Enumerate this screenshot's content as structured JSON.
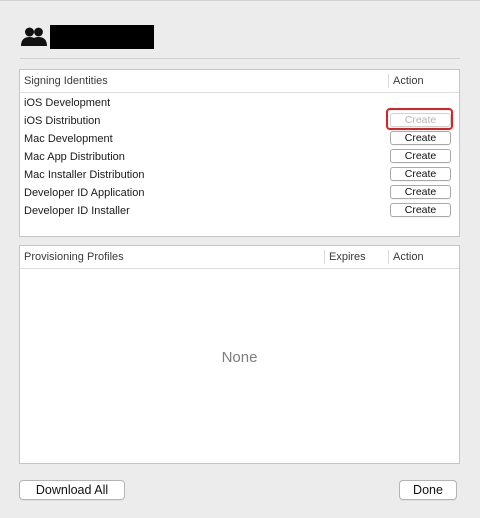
{
  "account": {
    "icon": "users-icon",
    "name": "",
    "redacted": true
  },
  "signing": {
    "col_name": "Signing Identities",
    "col_action": "Action",
    "rows": [
      {
        "name": "iOS Development",
        "action": "",
        "enabled": false
      },
      {
        "name": "iOS Distribution",
        "action": "Create",
        "enabled": false,
        "highlighted": true
      },
      {
        "name": "Mac Development",
        "action": "Create",
        "enabled": true
      },
      {
        "name": "Mac App Distribution",
        "action": "Create",
        "enabled": true
      },
      {
        "name": "Mac Installer Distribution",
        "action": "Create",
        "enabled": true
      },
      {
        "name": "Developer ID Application",
        "action": "Create",
        "enabled": true
      },
      {
        "name": "Developer ID Installer",
        "action": "Create",
        "enabled": true
      }
    ]
  },
  "profiles": {
    "col_name": "Provisioning Profiles",
    "col_expires": "Expires",
    "col_action": "Action",
    "empty_text": "None"
  },
  "footer": {
    "download_all": "Download All",
    "done": "Done"
  },
  "colors": {
    "background": "#ececec",
    "panel": "#ffffff",
    "highlight": "#e02020",
    "disabled_text": "#b5b5b5"
  }
}
